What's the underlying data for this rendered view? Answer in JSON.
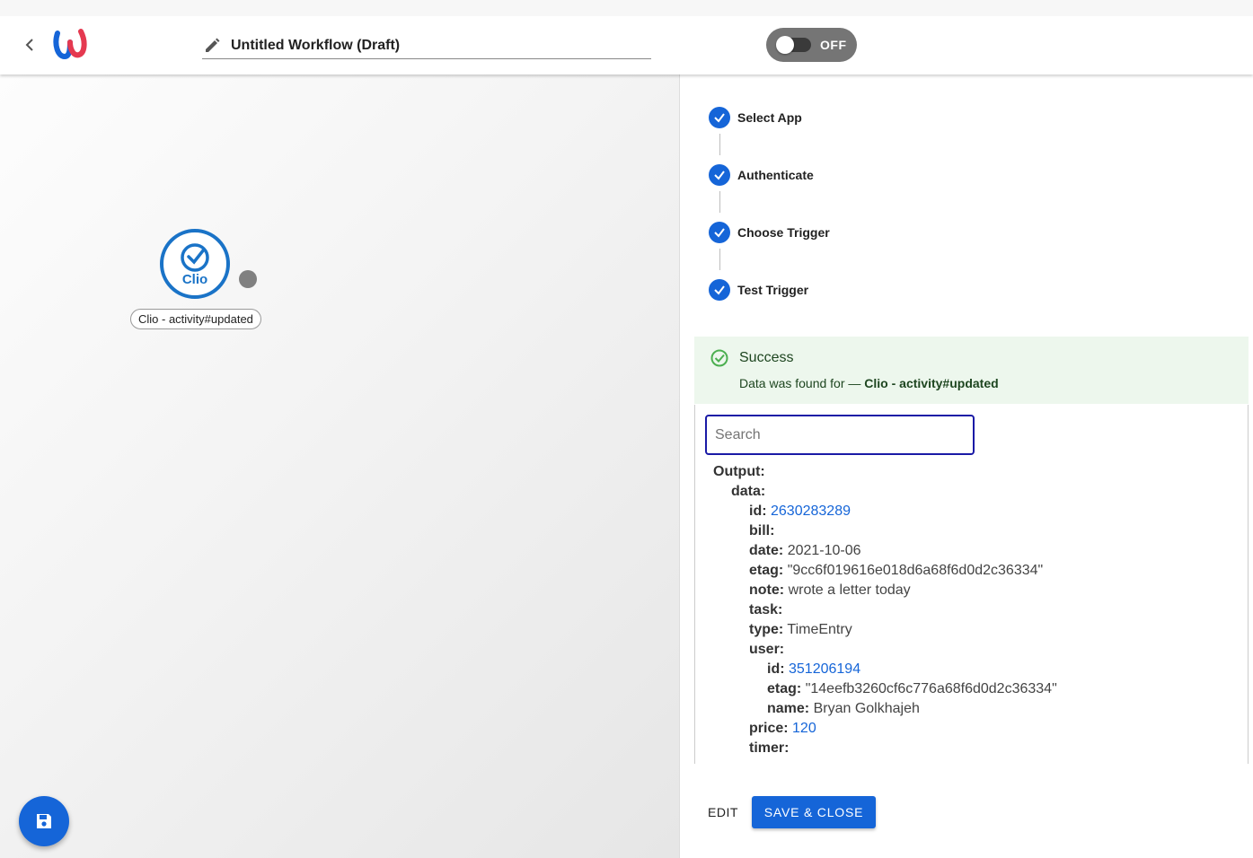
{
  "header": {
    "title": "Untitled Workflow (Draft)",
    "toggle_label": "OFF"
  },
  "canvas": {
    "node": {
      "logo_text": "Clio",
      "label": "Clio - activity#updated"
    }
  },
  "steps": [
    {
      "label": "Select App"
    },
    {
      "label": "Authenticate"
    },
    {
      "label": "Choose Trigger"
    },
    {
      "label": "Test Trigger"
    }
  ],
  "success": {
    "title": "Success",
    "message": "Data was found for —",
    "source": "Clio - activity#updated"
  },
  "search": {
    "placeholder": "Search",
    "value": ""
  },
  "output": {
    "root_key": "Output:",
    "rows": [
      {
        "key": "data:",
        "value": "",
        "type": "obj",
        "depth": 1
      },
      {
        "key": "id:",
        "value": "2630283289",
        "type": "num",
        "depth": 2
      },
      {
        "key": "bill:",
        "value": "",
        "type": "obj",
        "depth": 2
      },
      {
        "key": "date:",
        "value": "2021-10-06",
        "type": "str",
        "depth": 2
      },
      {
        "key": "etag:",
        "value": "\"9cc6f019616e018d6a68f6d0d2c36334\"",
        "type": "str",
        "depth": 2
      },
      {
        "key": "note:",
        "value": "wrote a letter today",
        "type": "str",
        "depth": 2
      },
      {
        "key": "task:",
        "value": "",
        "type": "obj",
        "depth": 2
      },
      {
        "key": "type:",
        "value": "TimeEntry",
        "type": "str",
        "depth": 2
      },
      {
        "key": "user:",
        "value": "",
        "type": "obj",
        "depth": 2
      },
      {
        "key": "id:",
        "value": "351206194",
        "type": "num",
        "depth": 3
      },
      {
        "key": "etag:",
        "value": "\"14eefb3260cf6c776a68f6d0d2c36334\"",
        "type": "str",
        "depth": 3
      },
      {
        "key": "name:",
        "value": "Bryan Golkhajeh",
        "type": "str",
        "depth": 3
      },
      {
        "key": "price:",
        "value": "120",
        "type": "num",
        "depth": 2
      },
      {
        "key": "timer:",
        "value": "",
        "type": "obj",
        "depth": 2
      }
    ]
  },
  "actions": {
    "edit_label": "EDIT",
    "save_label": "SAVE & CLOSE"
  },
  "colors": {
    "primary": "#1565d8",
    "success_bg": "#edf7ed",
    "toggle_bg": "#757575"
  }
}
